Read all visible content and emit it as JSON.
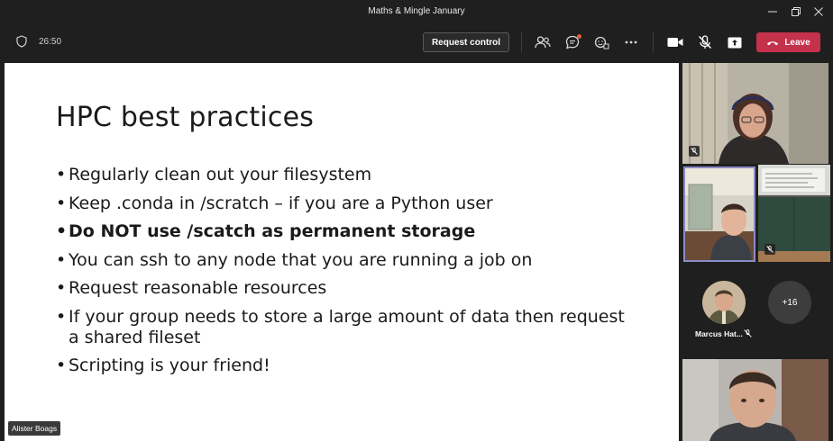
{
  "window": {
    "title": "Maths & Mingle January"
  },
  "toolbar": {
    "timer": "26:50",
    "request_control_label": "Request control",
    "leave_label": "Leave"
  },
  "slide": {
    "title": "HPC best practices",
    "bullets": [
      {
        "text": "Regularly clean out your filesystem",
        "bold": false
      },
      {
        "text": "Keep .conda in /scratch – if you are a Python user",
        "bold": false
      },
      {
        "text": "Do NOT use /scatch as permanent storage",
        "bold": true
      },
      {
        "text": "You can ssh to any node that you are running a job on",
        "bold": false
      },
      {
        "text": "Request reasonable resources",
        "bold": false
      },
      {
        "text": "If your group needs to store a large amount of data then request a shared fileset",
        "bold": false
      },
      {
        "text": "Scripting is your friend!",
        "bold": false
      }
    ],
    "presenter_name": "Alister Boags"
  },
  "participants": {
    "overflow_count": "+16",
    "named_tile_label": "Marcus Hat..."
  },
  "colors": {
    "leave_red": "#c4314b",
    "active_speaker_border": "#8b8cc7",
    "background": "#1f1f1f"
  },
  "icons": [
    "shield-icon",
    "people-icon",
    "chat-icon",
    "reactions-icon",
    "more-icon",
    "camera-icon",
    "mic-off-icon",
    "share-icon",
    "phone-icon",
    "minimize-icon",
    "restore-icon",
    "close-icon"
  ]
}
